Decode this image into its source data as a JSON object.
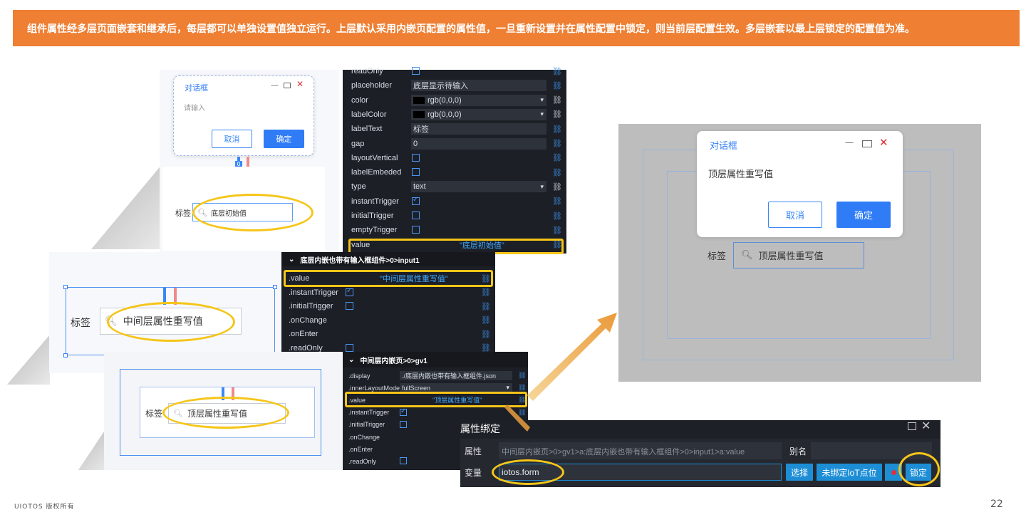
{
  "banner": {
    "text": "组件属性经多层页面嵌套和继承后，每层都可以单独设置值独立运行。上层默认采用内嵌页配置的属性值，一旦重新设置并在属性配置中锁定，则当前层配置生效。多层嵌套以最上层锁定的配置值为准。"
  },
  "footer": {
    "copyright": "UIOTOS 版权所有",
    "page_number": "22"
  },
  "bottom_layer": {
    "dialog_title": "对话框",
    "dialog_placeholder": "请输入",
    "cancel": "取消",
    "ok": "确定",
    "label": "标签",
    "input_value": "底层初始值"
  },
  "bottom_props": {
    "rows": [
      {
        "name": "readOnly"
      },
      {
        "name": "placeholder",
        "value": "底层显示待输入"
      },
      {
        "name": "color",
        "value": "rgb(0,0,0)"
      },
      {
        "name": "labelColor",
        "value": "rgb(0,0,0)"
      },
      {
        "name": "labelText",
        "value": "标签"
      },
      {
        "name": "gap",
        "value": "0"
      },
      {
        "name": "layoutVertical"
      },
      {
        "name": "labelEmbeded"
      },
      {
        "name": "type",
        "value": "text"
      },
      {
        "name": "instantTrigger"
      },
      {
        "name": "initialTrigger"
      },
      {
        "name": "emptyTrigger"
      },
      {
        "name": "value",
        "value": "\"底层初始值\""
      }
    ]
  },
  "middle_layer": {
    "label": "标签",
    "input_value": "中间层属性重写值"
  },
  "middle_props": {
    "header": "底层内嵌也带有输入框组件>0>input1",
    "rows": [
      {
        "name": ".value",
        "value": "\"中间层属性重写值\""
      },
      {
        "name": ".instantTrigger"
      },
      {
        "name": ".initialTrigger"
      },
      {
        "name": ".onChange"
      },
      {
        "name": ".onEnter"
      },
      {
        "name": ".readOnly"
      }
    ]
  },
  "top_layer": {
    "label": "标签",
    "input_value": "顶层属性重写值"
  },
  "top_props": {
    "header": "中间层内嵌页>0>gv1",
    "rows": [
      {
        "name": ".display",
        "value": "./底层内嵌也带有输入框组件.json"
      },
      {
        "name": ".innerLayoutMode",
        "value": "fullScreen"
      },
      {
        "name": ".value",
        "value": "\"顶层属性重写值\""
      },
      {
        "name": ".instantTrigger"
      },
      {
        "name": ".initialTrigger"
      },
      {
        "name": ".onChange"
      },
      {
        "name": ".onEnter"
      },
      {
        "name": ".readOnly"
      }
    ]
  },
  "binding_dialog": {
    "title": "属性绑定",
    "attr_label": "属性",
    "attr_value": "中间层内嵌页>0>gv1>a:底层内嵌也带有输入框组件>0>input1>a:value",
    "alias_label": "别名",
    "var_label": "变量",
    "var_value": "iotos.form",
    "select_btn": "选择",
    "unbound_btn": "未绑定IoT点位",
    "lock_btn": "锁定"
  },
  "preview": {
    "dialog_title": "对话框",
    "dialog_text": "顶层属性重写值",
    "cancel": "取消",
    "ok": "确定",
    "label": "标签",
    "input_value": "顶层属性重写值"
  }
}
